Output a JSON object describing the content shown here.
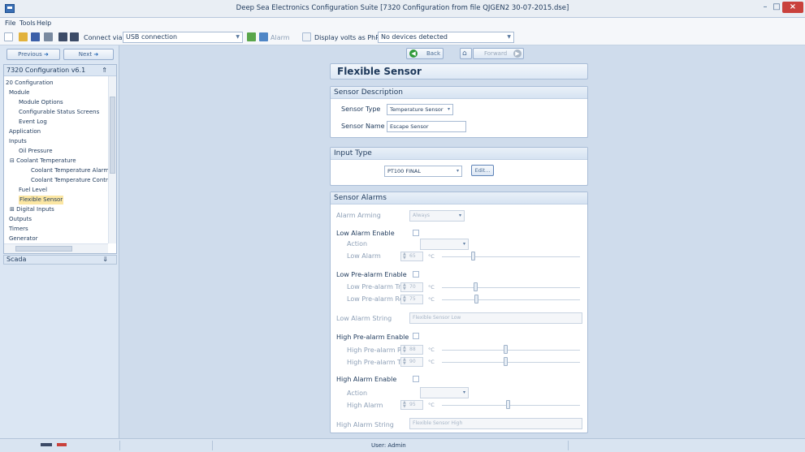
{
  "window": {
    "title": "Deep Sea Electronics Configuration Suite [7320 Configuration from file QJGEN2 30-07-2015.dse]",
    "min": "–",
    "max": "□",
    "close": "×"
  },
  "menu": {
    "items": [
      "File",
      "Tools",
      "Help"
    ]
  },
  "toolbar": {
    "connect_label": "Connect via",
    "connect_value": "USB connection",
    "alarm_label": "Alarm",
    "display_volts_label": "Display volts as PhPh",
    "devices_value": "No devices detected"
  },
  "nav": {
    "previous": "Previous",
    "next": "Next",
    "back": "Back",
    "forward": "Forward"
  },
  "tree": {
    "header": "7320 Configuration v6.1",
    "items": [
      "20 Configuration",
      "Module",
      "Module Options",
      "Configurable Status Screens",
      "Event Log",
      "Application",
      "Inputs",
      "Oil Pressure",
      "Coolant Temperature",
      "Coolant Temperature Alarms",
      "Coolant Temperature Contro",
      "Fuel Level",
      "Flexible Sensor",
      "Digital Inputs",
      "Outputs",
      "Timers",
      "Generator"
    ],
    "selected": "Flexible Sensor",
    "minus_glyph": "⊟",
    "plus_glyph": "⊞"
  },
  "scada": {
    "label": "Scada"
  },
  "page": {
    "title": "Flexible Sensor"
  },
  "sensor_description": {
    "heading": "Sensor Description",
    "type_label": "Sensor Type",
    "type_value": "Temperature Sensor",
    "name_label": "Sensor Name",
    "name_value": "Escape Sensor"
  },
  "input_type": {
    "heading": "Input Type",
    "value": "PT100 FINAL",
    "edit": "Edit..."
  },
  "sensor_alarms": {
    "heading": "Sensor Alarms",
    "arming_label": "Alarm Arming",
    "arming_value": "Always",
    "low_alarm_enable": "Low Alarm Enable",
    "action_label": "Action",
    "low_alarm_label": "Low Alarm",
    "low_alarm_value": "65",
    "low_prealarm_enable": "Low Pre-alarm Enable",
    "low_prealarm_trip_label": "Low Pre-alarm Trip",
    "low_prealarm_trip_value": "70",
    "low_prealarm_return_label": "Low Pre-alarm Return",
    "low_prealarm_return_value": "75",
    "low_alarm_string_label": "Low Alarm String",
    "low_alarm_string_value": "Flexible Sensor Low",
    "high_prealarm_enable": "High Pre-alarm Enable",
    "high_prealarm_return_label": "High Pre-alarm Return",
    "high_prealarm_return_value": "88",
    "high_prealarm_trip_label": "High Pre-alarm Trip",
    "high_prealarm_trip_value": "90",
    "high_alarm_enable": "High Alarm Enable",
    "high_action_label": "Action",
    "high_alarm_label": "High Alarm",
    "high_alarm_value": "95",
    "high_alarm_string_label": "High Alarm String",
    "high_alarm_string_value": "Flexible Sensor High",
    "unit": "°C"
  },
  "status": {
    "user": "User: Admin"
  },
  "colors": {
    "accent": "#1e395b",
    "selection": "#fbe6a3",
    "close": "#c9413c",
    "back_icon": "#2f9a3a"
  }
}
